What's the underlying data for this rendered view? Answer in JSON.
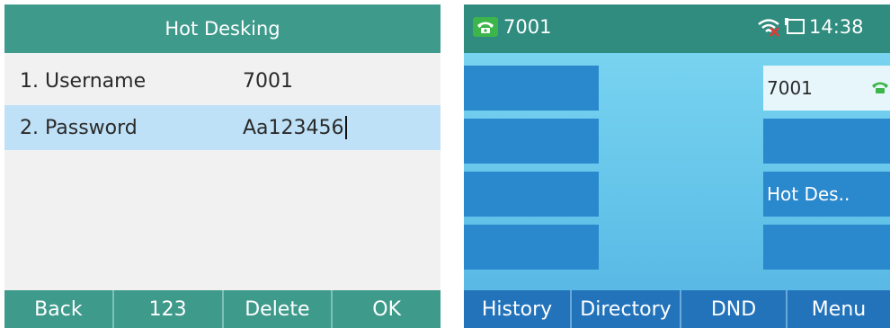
{
  "hot_desking": {
    "title": "Hot Desking",
    "fields": [
      {
        "label": "1. Username",
        "value": "7001"
      },
      {
        "label": "2. Password",
        "value": "Aa123456"
      }
    ],
    "softkeys": [
      "Back",
      "123",
      "Delete",
      "OK"
    ]
  },
  "idle": {
    "account": "7001",
    "time": "14:38",
    "icons": {
      "account": "phone-icon",
      "network": "wifi-off-icon",
      "display": "monitor-icon",
      "line_key": "phone-icon"
    },
    "right_keys": [
      "7001",
      "",
      "Hot Des..",
      ""
    ],
    "softkeys": [
      "History",
      "Directory",
      "DND",
      "Menu"
    ]
  },
  "colors": {
    "hd_header": "#3e9a8b",
    "hd_selected_row": "#bfe1f7",
    "idle_status_bar": "#2f8c7e",
    "idle_key": "#2a88cd",
    "idle_softkey_bar": "#2373bb",
    "phone_icon_green": "#3cb54a",
    "wifi_warning_red": "#e53935"
  }
}
